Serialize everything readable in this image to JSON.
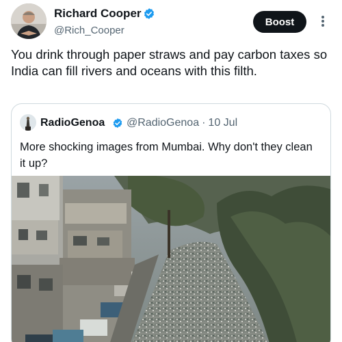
{
  "post": {
    "author": {
      "name": "Richard Cooper",
      "handle": "@Rich_Cooper",
      "verified": true,
      "avatar_icon": "user-avatar"
    },
    "actions": {
      "boost_label": "Boost",
      "more_icon": "more-options-icon"
    },
    "text": "You drink through paper straws and pay carbon taxes so India can fill rivers and oceans with this filth."
  },
  "quote": {
    "author": {
      "name": "RadioGenoa",
      "handle": "@RadioGenoa",
      "separator": "·",
      "date": "10 Jul",
      "verified": true,
      "avatar_icon": "radiogenoa-avatar"
    },
    "text": "More shocking images from Mumbai. Why don't they clean it up?",
    "media": {
      "type": "video-still",
      "icon": "polluted-canal-image"
    }
  },
  "colors": {
    "text": "#0f1419",
    "secondary": "#536471",
    "border": "#cfd9de",
    "verified": "#1d9bf0",
    "button": "#0f1419"
  }
}
